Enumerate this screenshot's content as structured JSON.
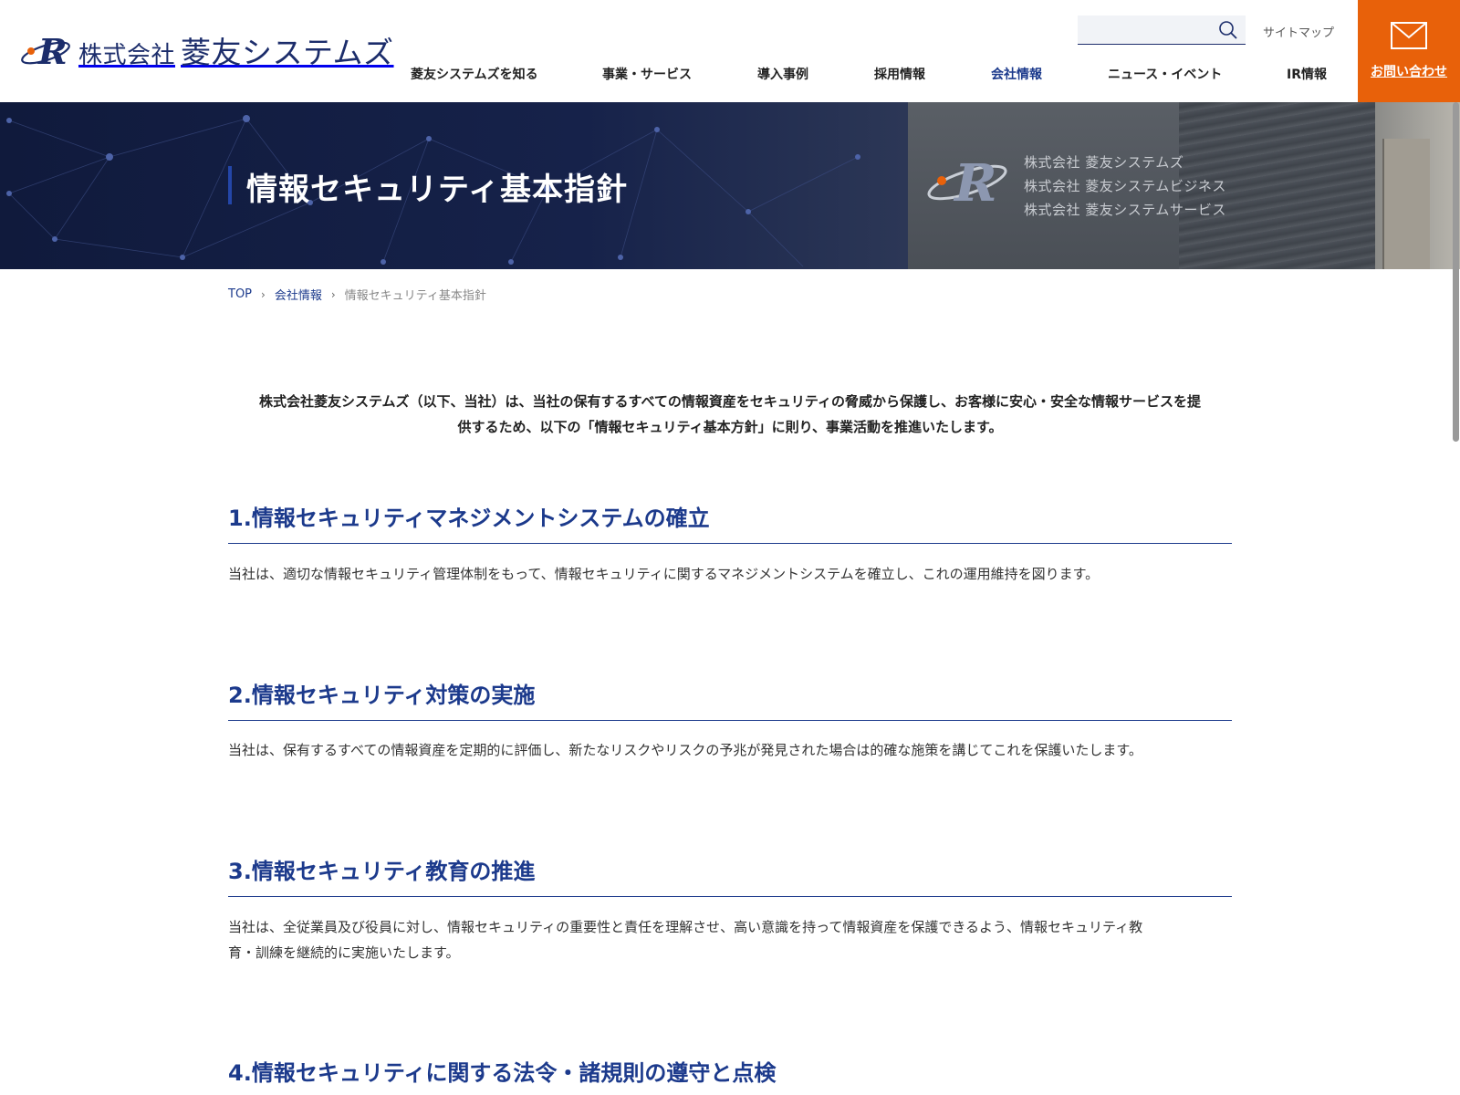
{
  "header": {
    "logo": {
      "company_prefix": "株式会社",
      "company_name": "菱友システムズ"
    },
    "search": {
      "placeholder": "",
      "value": ""
    },
    "sitemap_label": "サイトマップ",
    "contact_label": "お問い合わせ",
    "nav": [
      {
        "label": "菱友システムズを知る",
        "active": false
      },
      {
        "label": "事業・サービス",
        "active": false
      },
      {
        "label": "導入事例",
        "active": false
      },
      {
        "label": "採用情報",
        "active": false
      },
      {
        "label": "会社情報",
        "active": true
      },
      {
        "label": "ニュース・イベント",
        "active": false
      },
      {
        "label": "IR情報",
        "active": false
      }
    ],
    "accent_color": "#e8610a",
    "brand_color": "#1c2d6b"
  },
  "hero": {
    "title": "情報セキュリティ基本指針",
    "sign_lines": [
      "株式会社 菱友システムズ",
      "株式会社 菱友システムビジネス",
      "株式会社 菱友システムサービス"
    ]
  },
  "breadcrumb": {
    "items": [
      {
        "label": "TOP"
      },
      {
        "label": "会社情報"
      }
    ],
    "current": "情報セキュリティ基本指針"
  },
  "content": {
    "intro_line1": "株式会社菱友システムズ（以下、当社）は、当社の保有するすべての情報資産をセキュリティの脅威から保護し、お客様に安心・安全な情報サービスを提",
    "intro_line2": "供するため、以下の「情報セキュリティ基本方針」に則り、事業活動を推進いたします。",
    "sections": [
      {
        "title": "1.情報セキュリティマネジメントシステムの確立",
        "body": "当社は、適切な情報セキュリティ管理体制をもって、情報セキュリティに関するマネジメントシステムを確立し、これの運用維持を図ります。"
      },
      {
        "title": "2.情報セキュリティ対策の実施",
        "body": "当社は、保有するすべての情報資産を定期的に評価し、新たなリスクやリスクの予兆が発見された場合は的確な施策を講じてこれを保護いたします。"
      },
      {
        "title": "3.情報セキュリティ教育の推進",
        "body_line1": "当社は、全従業員及び役員に対し、情報セキュリティの重要性と責任を理解させ、高い意識を持って情報資産を保護できるよう、情報セキュリティ教",
        "body_line2": "育・訓練を継続的に実施いたします。"
      },
      {
        "title": "4.情報セキュリティに関する法令・諸規則の遵守と点検"
      }
    ]
  }
}
